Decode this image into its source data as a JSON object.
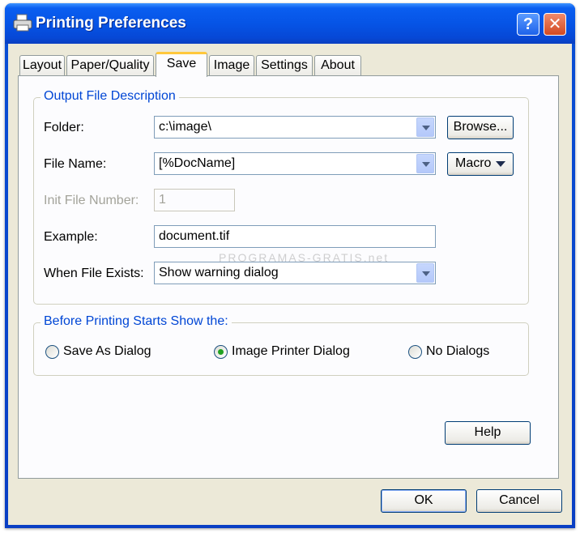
{
  "window": {
    "title": "Printing Preferences",
    "help_glyph": "?",
    "close_glyph": "✕"
  },
  "tabs": [
    {
      "label": "Layout"
    },
    {
      "label": "Paper/Quality"
    },
    {
      "label": "Save",
      "active": true
    },
    {
      "label": "Image"
    },
    {
      "label": "Settings"
    },
    {
      "label": "About"
    }
  ],
  "output_group": {
    "legend": "Output File Description",
    "folder_label": "Folder:",
    "folder_value": "c:\\image\\",
    "browse_label": "Browse...",
    "filename_label": "File Name:",
    "filename_value": "[%DocName]",
    "macro_label": "Macro",
    "init_label": "Init File Number:",
    "init_value": "1",
    "example_label": "Example:",
    "example_value": "document.tif",
    "exists_label": "When File Exists:",
    "exists_value": "Show warning dialog"
  },
  "before_group": {
    "legend": "Before Printing Starts Show the:",
    "options": [
      {
        "label": "Save As Dialog",
        "checked": false
      },
      {
        "label": "Image Printer Dialog",
        "checked": true
      },
      {
        "label": "No Dialogs",
        "checked": false
      }
    ]
  },
  "buttons": {
    "help": "Help",
    "ok": "OK",
    "cancel": "Cancel"
  },
  "watermark": "PROGRAMAS-GRATIS.net",
  "colors": {
    "titlebar": "#0654e6",
    "dialog_bg": "#ece9d8",
    "group_legend": "#0046d5",
    "radio_dot": "#21a121"
  }
}
